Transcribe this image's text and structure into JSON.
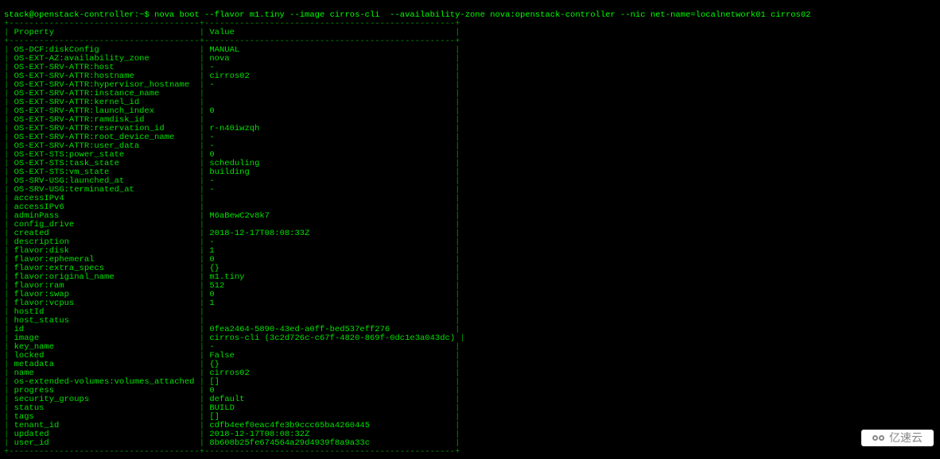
{
  "prompt": "stack@openstack-controller:~$ nova boot --flavor m1.tiny --image cirros-cli  --availability-zone nova:openstack-controller --nic net-name=localnetwork01 cirros02",
  "header": {
    "col1": "Property",
    "col2": "Value"
  },
  "border_top": "+--------------------------------------+--------------------------------------------------+",
  "border_header": "+--------------------------------------+--------------------------------------------------+",
  "border_bottom": "+--------------------------------------+--------------------------------------------------+",
  "rows": [
    {
      "property": "OS-DCF:diskConfig",
      "value": "MANUAL"
    },
    {
      "property": "OS-EXT-AZ:availability_zone",
      "value": "nova"
    },
    {
      "property": "OS-EXT-SRV-ATTR:host",
      "value": "-"
    },
    {
      "property": "OS-EXT-SRV-ATTR:hostname",
      "value": "cirros02"
    },
    {
      "property": "OS-EXT-SRV-ATTR:hypervisor_hostname",
      "value": "-"
    },
    {
      "property": "OS-EXT-SRV-ATTR:instance_name",
      "value": ""
    },
    {
      "property": "OS-EXT-SRV-ATTR:kernel_id",
      "value": ""
    },
    {
      "property": "OS-EXT-SRV-ATTR:launch_index",
      "value": "0"
    },
    {
      "property": "OS-EXT-SRV-ATTR:ramdisk_id",
      "value": ""
    },
    {
      "property": "OS-EXT-SRV-ATTR:reservation_id",
      "value": "r-n40iwzqh"
    },
    {
      "property": "OS-EXT-SRV-ATTR:root_device_name",
      "value": "-"
    },
    {
      "property": "OS-EXT-SRV-ATTR:user_data",
      "value": "-"
    },
    {
      "property": "OS-EXT-STS:power_state",
      "value": "0"
    },
    {
      "property": "OS-EXT-STS:task_state",
      "value": "scheduling"
    },
    {
      "property": "OS-EXT-STS:vm_state",
      "value": "building"
    },
    {
      "property": "OS-SRV-USG:launched_at",
      "value": "-"
    },
    {
      "property": "OS-SRV-USG:terminated_at",
      "value": "-"
    },
    {
      "property": "accessIPv4",
      "value": ""
    },
    {
      "property": "accessIPv6",
      "value": ""
    },
    {
      "property": "adminPass",
      "value": "M6aBewC2v8k7"
    },
    {
      "property": "config_drive",
      "value": ""
    },
    {
      "property": "created",
      "value": "2018-12-17T08:08:33Z"
    },
    {
      "property": "description",
      "value": "-"
    },
    {
      "property": "flavor:disk",
      "value": "1"
    },
    {
      "property": "flavor:ephemeral",
      "value": "0"
    },
    {
      "property": "flavor:extra_specs",
      "value": "{}"
    },
    {
      "property": "flavor:original_name",
      "value": "m1.tiny"
    },
    {
      "property": "flavor:ram",
      "value": "512"
    },
    {
      "property": "flavor:swap",
      "value": "0"
    },
    {
      "property": "flavor:vcpus",
      "value": "1"
    },
    {
      "property": "hostId",
      "value": ""
    },
    {
      "property": "host_status",
      "value": ""
    },
    {
      "property": "id",
      "value": "0fea2464-5890-43ed-a0ff-bed537eff276"
    },
    {
      "property": "image",
      "value": "cirros-cli (3c2d726c-c67f-4820-869f-0dc1e3a043dc)"
    },
    {
      "property": "key_name",
      "value": "-"
    },
    {
      "property": "locked",
      "value": "False"
    },
    {
      "property": "metadata",
      "value": "{}"
    },
    {
      "property": "name",
      "value": "cirros02"
    },
    {
      "property": "os-extended-volumes:volumes_attached",
      "value": "[]"
    },
    {
      "property": "progress",
      "value": "0"
    },
    {
      "property": "security_groups",
      "value": "default"
    },
    {
      "property": "status",
      "value": "BUILD"
    },
    {
      "property": "tags",
      "value": "[]"
    },
    {
      "property": "tenant_id",
      "value": "cdfb4eef0eac4fe3b9ccc65ba4260445"
    },
    {
      "property": "updated",
      "value": "2018-12-17T08:08:32Z"
    },
    {
      "property": "user_id",
      "value": "8b608b25fe674564a29d4939f8a9a33c"
    }
  ],
  "watermark_text": "亿速云"
}
